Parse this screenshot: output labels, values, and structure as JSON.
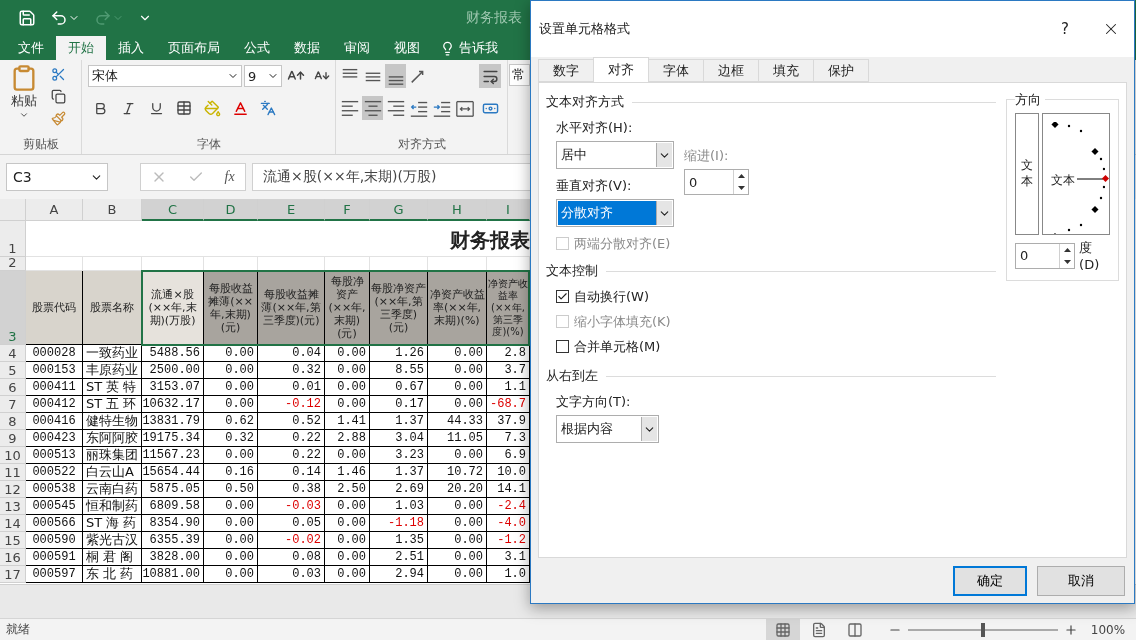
{
  "titlebar": {
    "title": "财务报表"
  },
  "menu_tabs": [
    {
      "label": "文件",
      "selected": false
    },
    {
      "label": "开始",
      "selected": true
    },
    {
      "label": "插入",
      "selected": false
    },
    {
      "label": "页面布局",
      "selected": false
    },
    {
      "label": "公式",
      "selected": false
    },
    {
      "label": "数据",
      "selected": false
    },
    {
      "label": "审阅",
      "selected": false
    },
    {
      "label": "视图",
      "selected": false
    }
  ],
  "tell_me": {
    "label": "告诉我"
  },
  "ribbon": {
    "clipboard": {
      "paste": "粘贴",
      "label": "剪贴板"
    },
    "font": {
      "name": "宋体",
      "size": "9",
      "label": "字体"
    },
    "align_top": [
      {
        "kind": "top",
        "selected": false
      },
      {
        "kind": "middle",
        "selected": false
      },
      {
        "kind": "bottom",
        "selected": true
      },
      {
        "kind": "orientation",
        "selected": false
      }
    ],
    "align_bottom": [
      {
        "kind": "left",
        "selected": false
      },
      {
        "kind": "center",
        "selected": true
      },
      {
        "kind": "right",
        "selected": false
      },
      {
        "kind": "outdent",
        "selected": false
      },
      {
        "kind": "indent",
        "selected": false
      },
      {
        "kind": "merge",
        "selected": false
      }
    ],
    "wrap": {
      "selected": true
    },
    "align_label": "对齐方式",
    "number_format": "常"
  },
  "formula_bar": {
    "name_box": "C3",
    "fx": "fx",
    "formula": "流通×股(××年,末期)(万股)"
  },
  "sheet": {
    "columns": [
      {
        "label": "A",
        "selected": false,
        "active": false
      },
      {
        "label": "B",
        "selected": false,
        "active": false
      },
      {
        "label": "C",
        "selected": true,
        "active": true
      },
      {
        "label": "D",
        "selected": true,
        "active": false
      },
      {
        "label": "E",
        "selected": true,
        "active": false
      },
      {
        "label": "F",
        "selected": true,
        "active": false
      },
      {
        "label": "G",
        "selected": true,
        "active": false
      },
      {
        "label": "H",
        "selected": true,
        "active": false
      },
      {
        "label": "I",
        "selected": true,
        "active": false
      }
    ],
    "title_row": {
      "row": "1",
      "text": "财务报表"
    },
    "blank_row": {
      "row": "2"
    },
    "header_row": {
      "row": "3",
      "selected": true,
      "cells": [
        "股票代码",
        "股票名称",
        "流通×股(××年,末期)(万股)",
        "每股收益摊薄(××年,末期)(元)",
        "每股收益摊薄(××年,第三季度)(元)",
        "每股净资产(××年,末期)(元)",
        "每股净资产(××年,第三季度)(元)",
        "净资产收益率(××年,末期)(%)",
        "净资产收益率(××年,第三季度)(%)"
      ]
    },
    "rows": [
      {
        "row": "4",
        "cells": [
          "000028",
          "一致药业",
          "5488.56",
          "0.00",
          "0.04",
          "0.00",
          "1.26",
          "0.00",
          "2.8"
        ],
        "red": [
          false,
          false,
          false,
          false,
          false,
          false,
          false,
          false,
          false
        ]
      },
      {
        "row": "5",
        "cells": [
          "000153",
          "丰原药业",
          "2500.00",
          "0.00",
          "0.32",
          "0.00",
          "8.55",
          "0.00",
          "3.7"
        ],
        "red": [
          false,
          false,
          false,
          false,
          false,
          false,
          false,
          false,
          false
        ]
      },
      {
        "row": "6",
        "cells": [
          "000411",
          "ST 英 特",
          "3153.07",
          "0.00",
          "0.01",
          "0.00",
          "0.67",
          "0.00",
          "1.1"
        ],
        "red": [
          false,
          false,
          false,
          false,
          false,
          false,
          false,
          false,
          false
        ]
      },
      {
        "row": "7",
        "cells": [
          "000412",
          "ST 五 环",
          "10632.17",
          "0.00",
          "-0.12",
          "0.00",
          "0.17",
          "0.00",
          "-68.7"
        ],
        "red": [
          false,
          false,
          false,
          false,
          true,
          false,
          false,
          false,
          true
        ]
      },
      {
        "row": "8",
        "cells": [
          "000416",
          "健特生物",
          "13831.79",
          "0.62",
          "0.52",
          "1.41",
          "1.37",
          "44.33",
          "37.9"
        ],
        "red": [
          false,
          false,
          false,
          false,
          false,
          false,
          false,
          false,
          false
        ]
      },
      {
        "row": "9",
        "cells": [
          "000423",
          "东阿阿胶",
          "19175.34",
          "0.32",
          "0.22",
          "2.88",
          "3.04",
          "11.05",
          "7.3"
        ],
        "red": [
          false,
          false,
          false,
          false,
          false,
          false,
          false,
          false,
          false
        ]
      },
      {
        "row": "10",
        "cells": [
          "000513",
          "丽珠集团",
          "11567.23",
          "0.00",
          "0.22",
          "0.00",
          "3.23",
          "0.00",
          "6.9"
        ],
        "red": [
          false,
          false,
          false,
          false,
          false,
          false,
          false,
          false,
          false
        ]
      },
      {
        "row": "11",
        "cells": [
          "000522",
          "白云山A",
          "15654.44",
          "0.16",
          "0.14",
          "1.46",
          "1.37",
          "10.72",
          "10.0"
        ],
        "red": [
          false,
          false,
          false,
          false,
          false,
          false,
          false,
          false,
          false
        ]
      },
      {
        "row": "12",
        "cells": [
          "000538",
          "云南白药",
          "5875.05",
          "0.50",
          "0.38",
          "2.50",
          "2.69",
          "20.20",
          "14.1"
        ],
        "red": [
          false,
          false,
          false,
          false,
          false,
          false,
          false,
          false,
          false
        ]
      },
      {
        "row": "13",
        "cells": [
          "000545",
          "恒和制药",
          "6809.58",
          "0.00",
          "-0.03",
          "0.00",
          "1.03",
          "0.00",
          "-2.4"
        ],
        "red": [
          false,
          false,
          false,
          false,
          true,
          false,
          false,
          false,
          true
        ]
      },
      {
        "row": "14",
        "cells": [
          "000566",
          "ST 海 药",
          "8354.90",
          "0.00",
          "0.05",
          "0.00",
          "-1.18",
          "0.00",
          "-4.0"
        ],
        "red": [
          false,
          false,
          false,
          false,
          false,
          false,
          true,
          false,
          true
        ]
      },
      {
        "row": "15",
        "cells": [
          "000590",
          "紫光古汉",
          "6355.39",
          "0.00",
          "-0.02",
          "0.00",
          "1.35",
          "0.00",
          "-1.2"
        ],
        "red": [
          false,
          false,
          false,
          false,
          true,
          false,
          false,
          false,
          true
        ]
      },
      {
        "row": "16",
        "cells": [
          "000591",
          "桐 君 阁",
          "3828.00",
          "0.00",
          "0.08",
          "0.00",
          "2.51",
          "0.00",
          "3.1"
        ],
        "red": [
          false,
          false,
          false,
          false,
          false,
          false,
          false,
          false,
          false
        ]
      },
      {
        "row": "17",
        "cells": [
          "000597",
          "东 北 药",
          "10881.00",
          "0.00",
          "0.03",
          "0.00",
          "2.94",
          "0.00",
          "1.0"
        ],
        "red": [
          false,
          false,
          false,
          false,
          false,
          false,
          false,
          false,
          false
        ]
      }
    ]
  },
  "status_bar": {
    "text": "就绪",
    "views": [
      {
        "kind": "normal",
        "selected": true
      },
      {
        "kind": "page_layout",
        "selected": false
      },
      {
        "kind": "page_break",
        "selected": false
      }
    ],
    "zoom": {
      "level": 0.5,
      "value": "100%"
    }
  },
  "dialog": {
    "title": "设置单元格格式",
    "help": "?",
    "tabs": [
      {
        "label": "数字",
        "selected": false
      },
      {
        "label": "对齐",
        "selected": true
      },
      {
        "label": "字体",
        "selected": false
      },
      {
        "label": "边框",
        "selected": false
      },
      {
        "label": "填充",
        "selected": false
      },
      {
        "label": "保护",
        "selected": false
      }
    ],
    "alignment": {
      "title": "文本对齐方式",
      "horizontal": {
        "label": "水平对齐(H):",
        "value": "居中",
        "focused": false
      },
      "indent": {
        "label": "缩进(I):",
        "value": "0",
        "disabled": true
      },
      "vertical": {
        "label": "垂直对齐(V):",
        "value": "分散对齐",
        "focused": true
      },
      "justify_distributed": {
        "label": "两端分散对齐(E)",
        "checked": false,
        "disabled": true
      }
    },
    "text_control": {
      "title": "文本控制",
      "options": [
        {
          "label": "自动换行(W)",
          "checked": true,
          "disabled": false
        },
        {
          "label": "缩小字体填充(K)",
          "checked": false,
          "disabled": true
        },
        {
          "label": "合并单元格(M)",
          "checked": false,
          "disabled": false
        }
      ]
    },
    "right_to_left": {
      "title": "从右到左",
      "direction": {
        "label": "文字方向(T):",
        "value": "根据内容",
        "focused": false
      }
    },
    "orientation": {
      "title": "方向",
      "vertical_text": "文本",
      "dial_text": "文本",
      "degrees": {
        "value": "0",
        "label": "度(D)"
      }
    },
    "buttons": [
      {
        "label": "确定",
        "default": true
      },
      {
        "label": "取消",
        "default": false
      }
    ]
  }
}
